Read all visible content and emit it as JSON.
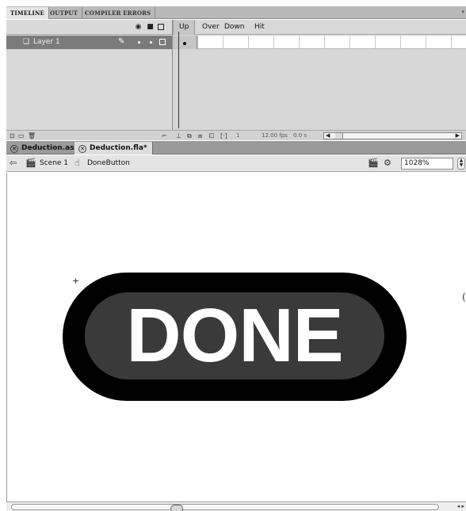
{
  "panel_tabs": [
    "TIMELINE",
    "OUTPUT",
    "COMPILER ERRORS"
  ],
  "timeline": {
    "header_icons": [
      "eye-icon",
      "lock-icon",
      "outline-icon"
    ],
    "frame_labels": [
      "Up",
      "Over",
      "Down",
      "Hit"
    ],
    "current_frame_label": "Up",
    "layer_name": "Layer 1",
    "status": {
      "frame": "1",
      "fps": "12.00 fps",
      "time": "0.0 s"
    }
  },
  "doc_tabs": [
    "Deduction.as",
    "Deduction.fla*"
  ],
  "active_doc_tab": "Deduction.fla*",
  "edit_bar": {
    "scene": "Scene 1",
    "symbol": "DoneButton",
    "zoom": "1028%"
  },
  "stage": {
    "button_text": "DONE"
  },
  "colors": {
    "button_outer": "#000000",
    "button_inner": "#3a3a3a",
    "button_text": "#ffffff"
  }
}
